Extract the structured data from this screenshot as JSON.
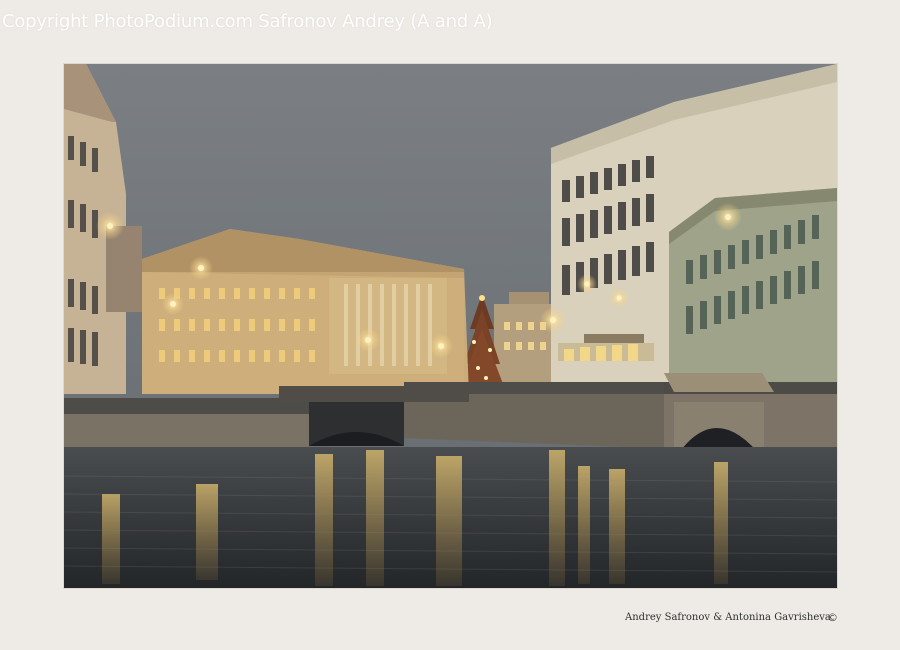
{
  "watermark": {
    "text": "Copyright PhotoPodium.com Safronov Andrey  (A and A)"
  },
  "credit": {
    "text": "Andrey Safronov & Antonina Gavrisheva",
    "mark": "©"
  },
  "colors": {
    "background": "#eeebe6",
    "sky": "#6f7479",
    "water": "#34373a",
    "lamp_glow": "#f6d48a"
  }
}
